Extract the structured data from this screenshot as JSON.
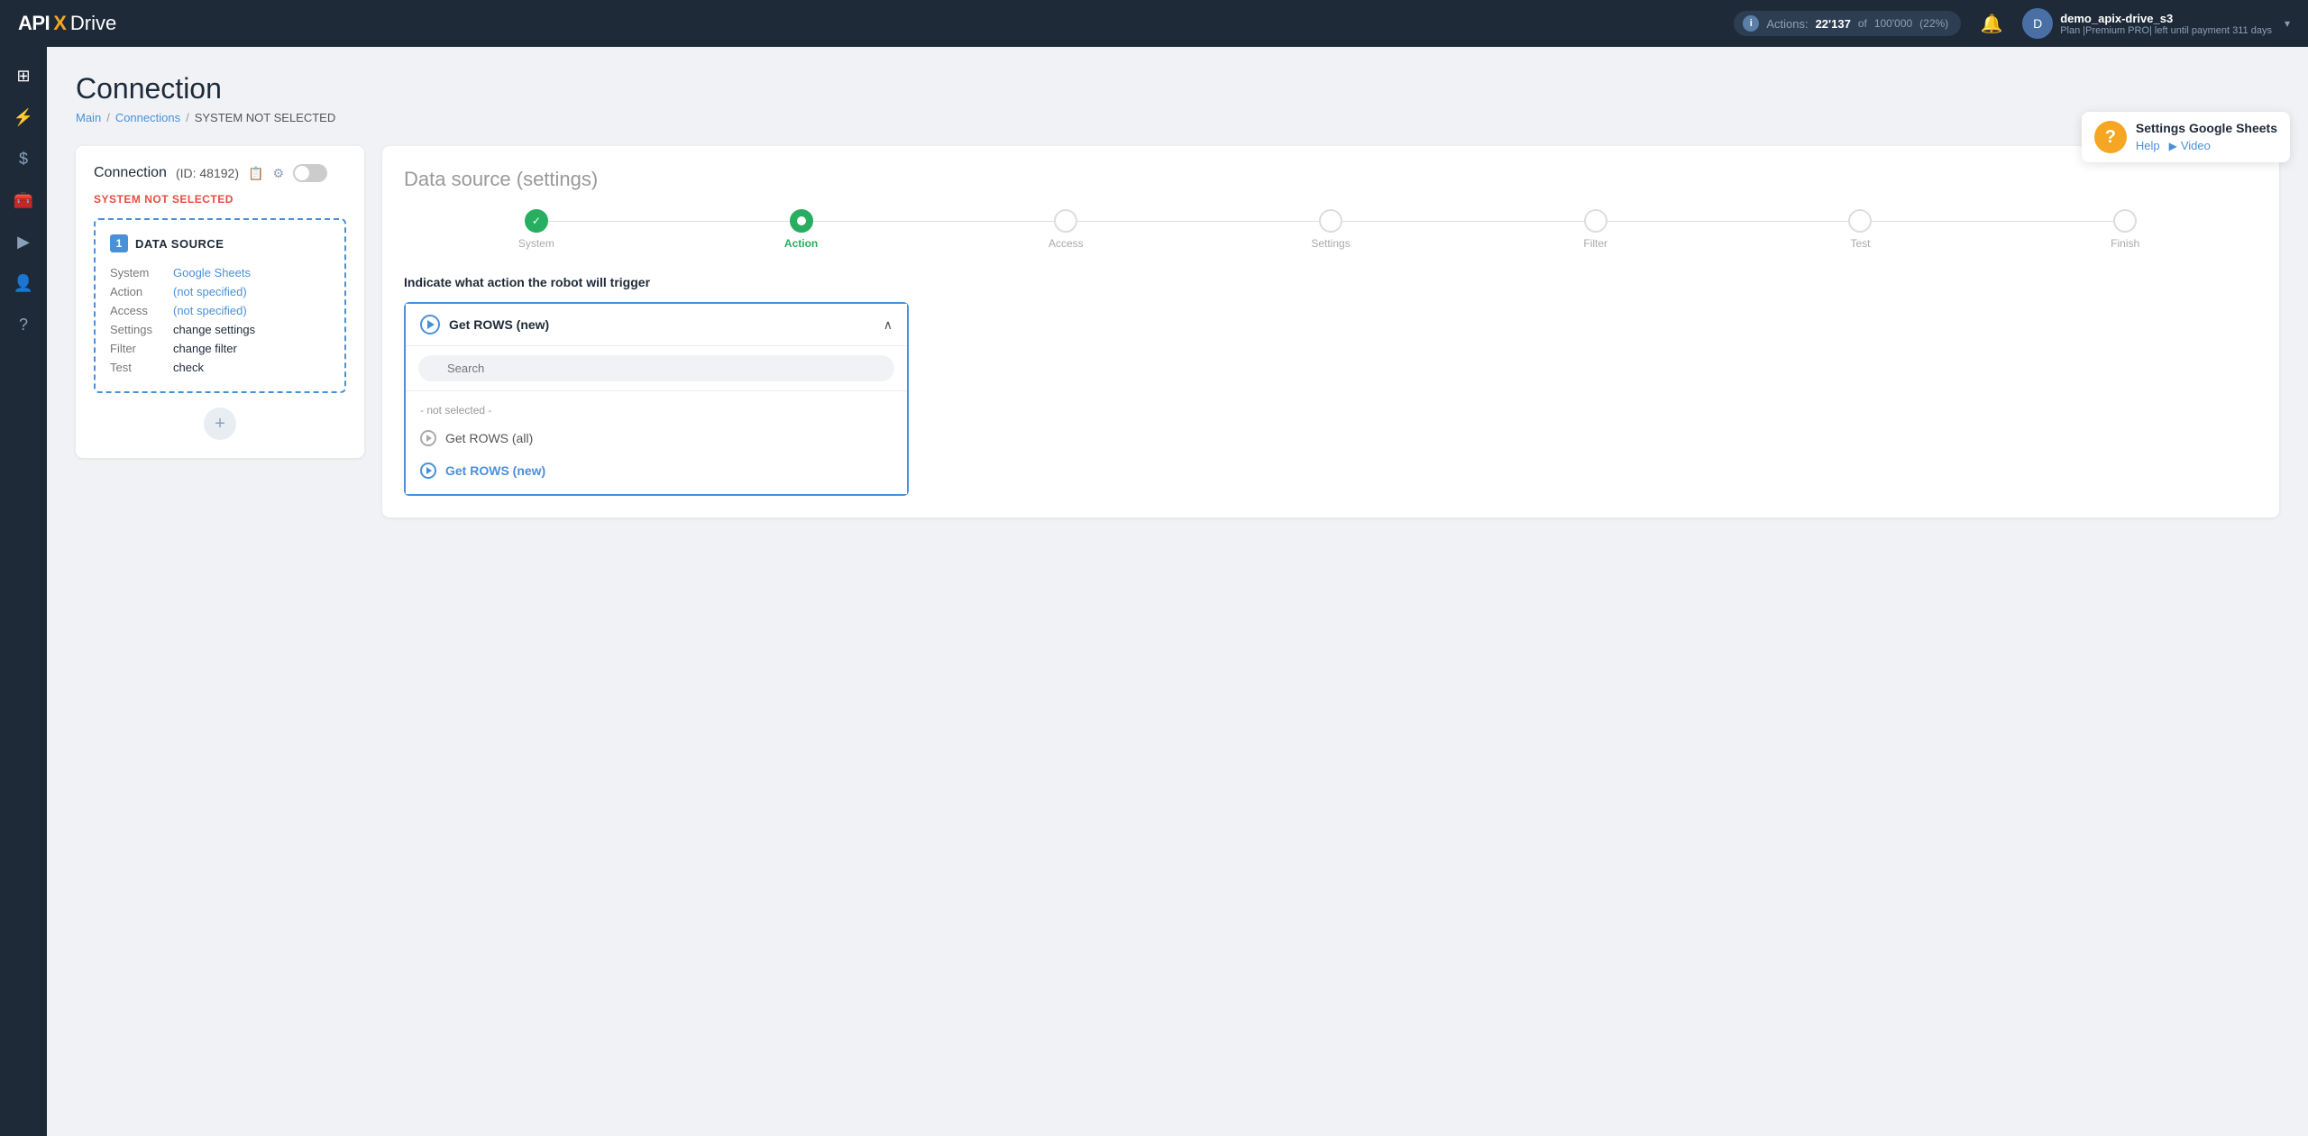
{
  "navbar": {
    "logo": {
      "api": "API",
      "x": "X",
      "drive": "Drive"
    },
    "actions": {
      "label": "Actions:",
      "count": "22'137",
      "of": "of",
      "total": "100'000",
      "pct": "(22%)"
    },
    "user": {
      "name": "demo_apix-drive_s3",
      "plan": "Plan |Premium PRO| left until payment 311 days",
      "avatar_initial": "D"
    }
  },
  "sidebar": {
    "items": [
      {
        "icon": "⊞",
        "name": "home",
        "label": "Home"
      },
      {
        "icon": "⚡",
        "name": "connections",
        "label": "Connections"
      },
      {
        "icon": "$",
        "name": "billing",
        "label": "Billing"
      },
      {
        "icon": "🧰",
        "name": "tools",
        "label": "Tools"
      },
      {
        "icon": "▶",
        "name": "video",
        "label": "Video"
      },
      {
        "icon": "👤",
        "name": "profile",
        "label": "Profile"
      },
      {
        "icon": "?",
        "name": "help",
        "label": "Help"
      }
    ]
  },
  "help_badge": {
    "title": "Settings Google Sheets",
    "help_label": "Help",
    "video_label": "Video"
  },
  "page": {
    "title": "Connection",
    "breadcrumb": {
      "main": "Main",
      "connections": "Connections",
      "current": "SYSTEM NOT SELECTED"
    }
  },
  "left_card": {
    "title": "Connection",
    "id_label": "(ID: 48192)",
    "system_status": "SYSTEM",
    "system_status_highlight": "NOT SELECTED",
    "data_source": {
      "number": "1",
      "title": "DATA SOURCE",
      "rows": [
        {
          "label": "System",
          "value": "Google Sheets",
          "is_link": true
        },
        {
          "label": "Action",
          "value": "(not specified)",
          "is_link": true
        },
        {
          "label": "Access",
          "value": "(not specified)",
          "is_link": true
        },
        {
          "label": "Settings",
          "value": "change settings",
          "is_link": false
        },
        {
          "label": "Filter",
          "value": "change filter",
          "is_link": false
        },
        {
          "label": "Test",
          "value": "check",
          "is_link": false
        }
      ]
    },
    "add_button": "+"
  },
  "right_card": {
    "title": "Data source",
    "title_sub": "(settings)",
    "steps": [
      {
        "label": "System",
        "state": "completed"
      },
      {
        "label": "Action",
        "state": "active"
      },
      {
        "label": "Access",
        "state": "inactive"
      },
      {
        "label": "Settings",
        "state": "inactive"
      },
      {
        "label": "Filter",
        "state": "inactive"
      },
      {
        "label": "Test",
        "state": "inactive"
      },
      {
        "label": "Finish",
        "state": "inactive"
      }
    ],
    "action_instruction": "Indicate what action the robot will trigger",
    "dropdown": {
      "selected": "Get ROWS (new)",
      "search_placeholder": "Search",
      "section_label": "- not selected -",
      "options": [
        {
          "label": "Get ROWS (all)",
          "selected": false
        },
        {
          "label": "Get ROWS (new)",
          "selected": true
        }
      ]
    }
  }
}
